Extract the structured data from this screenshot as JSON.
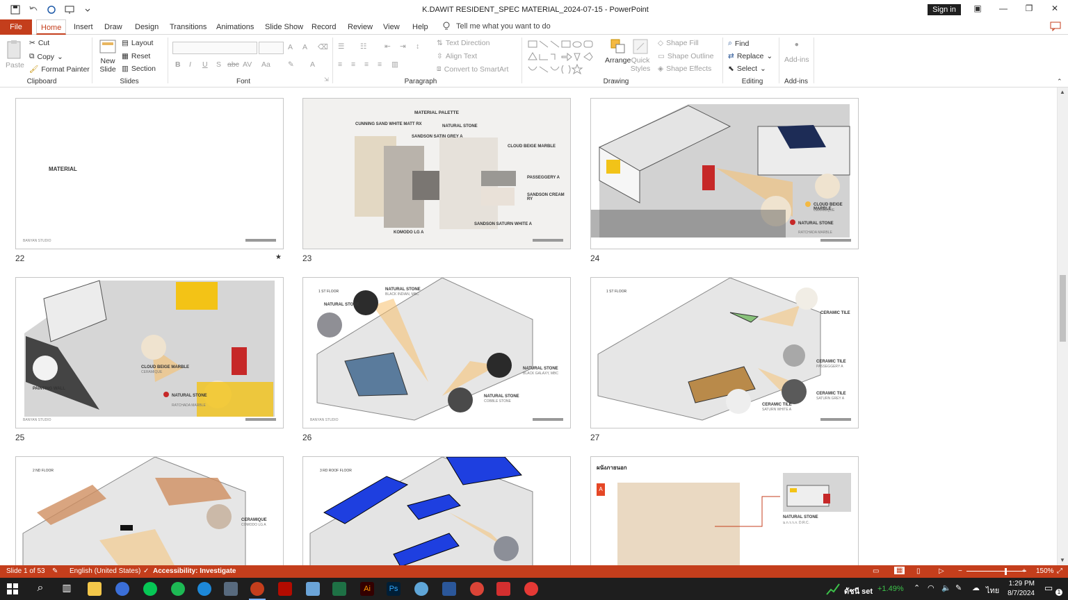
{
  "window": {
    "title": "K.DAWIT RESIDENT_SPEC MATERIAL_2024-07-15  -  PowerPoint",
    "sign_in": "Sign in"
  },
  "tabs": [
    "File",
    "Home",
    "Insert",
    "Draw",
    "Design",
    "Transitions",
    "Animations",
    "Slide Show",
    "Record",
    "Review",
    "View",
    "Help"
  ],
  "active_tab": "Home",
  "tell_me": "Tell me what you want to do",
  "ribbon": {
    "clipboard": {
      "paste": "Paste",
      "cut": "Cut",
      "copy": "Copy",
      "format_painter": "Format Painter",
      "label": "Clipboard"
    },
    "slides": {
      "new_slide": "New Slide",
      "layout": "Layout",
      "reset": "Reset",
      "section": "Section",
      "label": "Slides"
    },
    "font": {
      "label": "Font",
      "bold": "B",
      "italic": "I",
      "underline": "U",
      "shadow": "S",
      "strike": "abc",
      "spacing": "AV",
      "case": "Aa",
      "grow": "A",
      "shrink": "A"
    },
    "paragraph": {
      "label": "Paragraph",
      "text_direction": "Text Direction",
      "align_text": "Align Text",
      "smartart": "Convert to SmartArt"
    },
    "drawing": {
      "label": "Drawing",
      "arrange": "Arrange",
      "quick_styles": "Quick Styles",
      "shape_fill": "Shape Fill",
      "shape_outline": "Shape Outline",
      "shape_effects": "Shape Effects"
    },
    "editing": {
      "label": "Editing",
      "find": "Find",
      "replace": "Replace",
      "select": "Select"
    },
    "addins": {
      "label": "Add-ins",
      "addins": "Add-ins"
    }
  },
  "slides": [
    {
      "num": "22",
      "star": "★",
      "title": "MATERIAL",
      "footer_left": "BANYAN STUDIO"
    },
    {
      "num": "23",
      "title": "MATERIAL PALETTE",
      "footer_left": "",
      "labels": [
        "CUNNING SAND WHITE MATT RX",
        "SANDSON SATIN GREY A",
        "NATURAL STONE",
        "CLOUD BEIGE MARBLE",
        "PASSEGGERY A",
        "SANDSON CREAM RY",
        "KOMODO LG A",
        "SANDSON SATURN WHITE A"
      ]
    },
    {
      "num": "24",
      "footer_left": "",
      "labels": [
        "CLOUD BEIGE MARBLE",
        "CERAMIQUE",
        "NATURAL STONE",
        "RATCHADA MARBLE"
      ]
    },
    {
      "num": "25",
      "footer_left": "BANYAN STUDIO",
      "labels": [
        "CLOUD BEIGE MARBLE",
        "CERAMIQUE",
        "NATURAL STONE",
        "RATCHADA MARBLE",
        "PAINTING WALL"
      ]
    },
    {
      "num": "26",
      "floor": "1 ST FLOOR",
      "footer_left": "BANYAN STUDIO",
      "labels": [
        "NATURAL STONE",
        "BLACK INDIAN, MBC",
        "NATURAL STONE",
        "NATURAL STONE",
        "BLACK GALAXY, MBC",
        "NATURAL STONE",
        "COBBLE STONE"
      ]
    },
    {
      "num": "27",
      "floor": "1 ST FLOOR",
      "footer_left": "",
      "labels": [
        "CERAMIC TILE",
        "CERAMIC TILE",
        "PASSEGGERY A",
        "CERAMIC TILE",
        "SATURN GREY A",
        "CERAMIC TILE",
        "SATURN WHITE A"
      ]
    },
    {
      "num": "28",
      "floor": "2 ND FLOOR",
      "labels": [
        "CERAMIQUE",
        "COMODO LG A"
      ]
    },
    {
      "num": "29",
      "floor": "3 RD ROOF FLOOR"
    },
    {
      "num": "30",
      "thai_title": "ผนังภายนอก",
      "letter": "A",
      "labels": [
        "NATURAL STONE",
        "ม.ก.ร.ร.ก. D.R.C."
      ]
    }
  ],
  "status": {
    "slide": "Slide 1 of 53",
    "language": "English (United States)",
    "accessibility": "Accessibility: Investigate",
    "zoom": "150%"
  },
  "taskbar": {
    "stock_name": "ดัชนี set",
    "stock_change": "+1.49%",
    "thai_lang": "ไทย",
    "time": "1:29 PM",
    "date": "8/7/2024",
    "notifications": "1"
  },
  "colors": {
    "accent": "#c43e1c",
    "taskbar": "#1e1e1e",
    "stock_up": "#3cc34a"
  }
}
